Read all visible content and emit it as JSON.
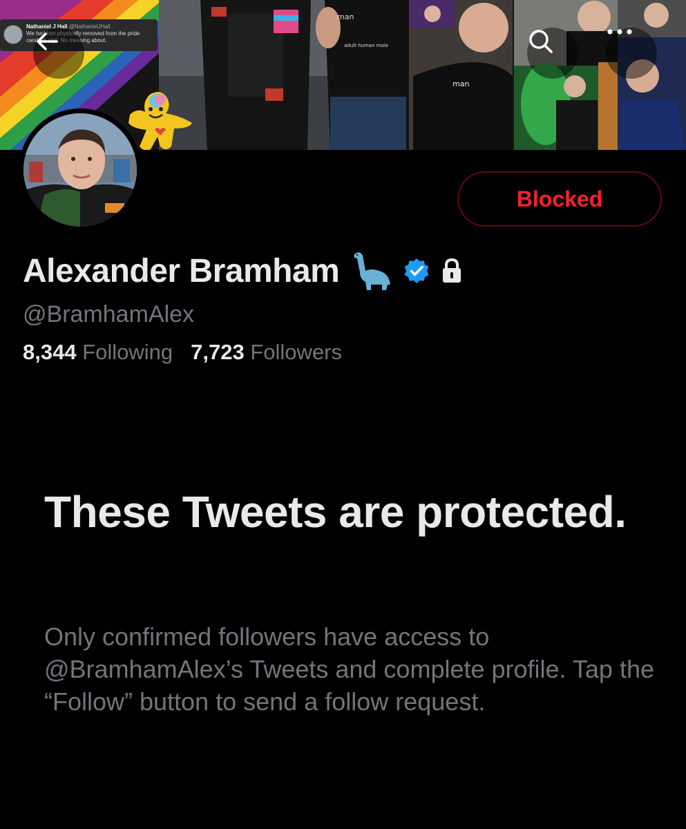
{
  "banner": {
    "quote_author": "Nathaniel J Hall",
    "quote_handle": "@NathanielJHall",
    "quote_text": "We had him physically removed from the pride candlelit vigil. No messing about.",
    "shirt_text_1": "man",
    "shirt_text_2": "adult human male"
  },
  "nav": {
    "back_icon": "back-arrow-icon",
    "search_icon": "search-icon",
    "more_icon": "more-horizontal-icon"
  },
  "profile": {
    "display_name": "Alexander Bramham",
    "handle": "@BramhamAlex",
    "following_count": "8,344",
    "following_label": "Following",
    "followers_count": "7,723",
    "followers_label": "Followers",
    "block_button_label": "Blocked"
  },
  "protected": {
    "title": "These Tweets are protected.",
    "body": "Only confirmed followers have access to @BramhamAlex’s Tweets and complete profile. Tap the “Follow” button to send a follow request."
  },
  "colors": {
    "background": "#000000",
    "primary_text": "#e7e9ea",
    "secondary_text": "#71767b",
    "blocked_red": "#f4212e",
    "verified_blue": "#1d9bf0"
  }
}
